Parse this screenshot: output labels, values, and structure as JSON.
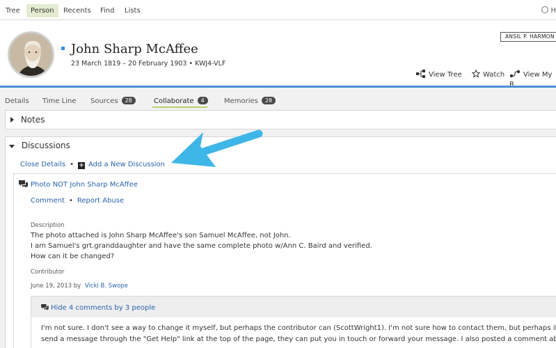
{
  "topnav": {
    "items": [
      "Tree",
      "Person",
      "Recents",
      "Find",
      "Lists"
    ],
    "active": "Person",
    "help_label": "H"
  },
  "person": {
    "name": "John Sharp McAffee",
    "lifespan": "23 March 1819 – 20 February 1903 • KWJ4-VLF",
    "badge": "ANSIL P. HARMON"
  },
  "actions": {
    "view_tree": "View Tree",
    "watch": "Watch",
    "view_my": "View My R"
  },
  "tabs": [
    {
      "label": "Details"
    },
    {
      "label": "Time Line"
    },
    {
      "label": "Sources",
      "count": "28"
    },
    {
      "label": "Collaborate",
      "count": "4"
    },
    {
      "label": "Memories",
      "count": "28"
    }
  ],
  "notes": {
    "title": "Notes"
  },
  "discussions": {
    "title": "Discussions",
    "close_details": "Close Details",
    "add_new": "Add a New Discussion",
    "topic": {
      "title": "Photo NOT John Sharp McAffee",
      "comment": "Comment",
      "report": "Report Abuse",
      "description_label": "Description",
      "description_lines": [
        "The photo attached is John Sharp McAffee's son Samuel McAffee, not John.",
        "I am Samuel's grt.granddaughter and have the same complete photo w/Ann C. Baird and verified.",
        "How can it be changed?"
      ],
      "contributor_label": "Contributor",
      "contributor_date": "June 19, 2013 by",
      "contributor_name": "Vicki B. Swope",
      "hide_comments": "Hide 4 comments by 3 people",
      "comment_lines": [
        "I'm not sure. I don't see a way to change it myself, but perhaps the contributor can (ScottWright1). I'm not sure how to contact them, but perhaps if you",
        "send a message through the \"Get Help\" link at the top of the page, they can put you in touch or forward your message. I also posted a comment about"
      ]
    }
  },
  "colors": {
    "accent_blue": "#4b8ed6",
    "link": "#2a63ad",
    "arrow": "#3fb6e8",
    "active_nav": "#e3ecd0",
    "tab_underline": "#b9d36b"
  }
}
